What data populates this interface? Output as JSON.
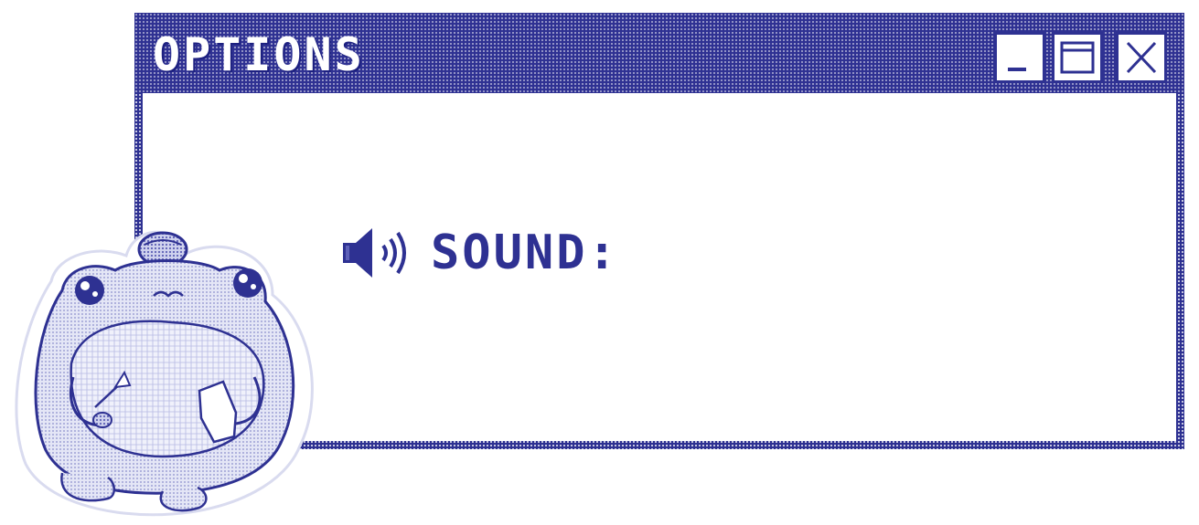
{
  "window": {
    "title": "OPTIONS",
    "controls": {
      "minimize": "minimize-icon",
      "maximize": "maximize-icon",
      "close": "close-icon"
    }
  },
  "options": {
    "sound_label": "SOUND:",
    "sound_icon": "speaker-icon"
  },
  "decoration": {
    "sticker": "frog-mascot-illustration"
  },
  "colors": {
    "accent": "#2e3192",
    "background": "#ffffff",
    "sticker_fill": "#dfe1f4"
  }
}
